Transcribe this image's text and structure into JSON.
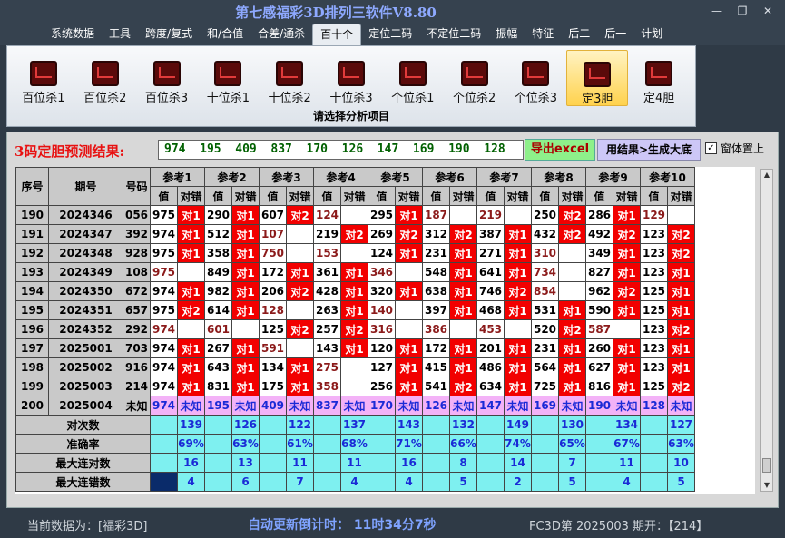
{
  "app": {
    "title": "第七感福彩3D排列三软件V8.80"
  },
  "window_controls": [
    "—",
    "❐",
    "✕"
  ],
  "menu": [
    "系统数据",
    "工具",
    "跨度/复式",
    "和/合值",
    "合差/通杀",
    "百十个",
    "定位二码",
    "不定位二码",
    "振幅",
    "特征",
    "后二",
    "后一",
    "计划"
  ],
  "menu_active": "百十个",
  "ribbon": {
    "items": [
      "百位杀1",
      "百位杀2",
      "百位杀3",
      "十位杀1",
      "十位杀2",
      "十位杀3",
      "个位杀1",
      "个位杀2",
      "个位杀3",
      "定3胆",
      "定4胆"
    ],
    "selected": "定3胆",
    "caption": "请选择分析项目"
  },
  "result": {
    "label": "3码定胆预测结果:",
    "value": "974  195  409  837  170  126  147  169  190  128",
    "export_button": "导出excel",
    "generate_button": "用结果>生成大底",
    "topmost_label": "窗体置上",
    "topmost_checked": true
  },
  "table": {
    "headers": {
      "seq": "序号",
      "period": "期号",
      "number": "号码",
      "value": "值",
      "result": "对错"
    },
    "ref_labels": [
      "参考1",
      "参考2",
      "参考3",
      "参考4",
      "参考5",
      "参考6",
      "参考7",
      "参考8",
      "参考9",
      "参考10"
    ],
    "rows": [
      {
        "seq": "190",
        "period": "2024346",
        "number": "056",
        "cells": [
          [
            "975",
            "对1"
          ],
          [
            "290",
            "对1"
          ],
          [
            "607",
            "对2"
          ],
          [
            "124",
            ""
          ],
          [
            "295",
            "对1"
          ],
          [
            "187",
            ""
          ],
          [
            "219",
            ""
          ],
          [
            "250",
            "对2"
          ],
          [
            "286",
            "对1"
          ],
          [
            "129",
            ""
          ]
        ]
      },
      {
        "seq": "191",
        "period": "2024347",
        "number": "392",
        "cells": [
          [
            "974",
            "对1"
          ],
          [
            "512",
            "对1"
          ],
          [
            "107",
            ""
          ],
          [
            "219",
            "对2"
          ],
          [
            "269",
            "对2"
          ],
          [
            "312",
            "对2"
          ],
          [
            "387",
            "对1"
          ],
          [
            "432",
            "对2"
          ],
          [
            "492",
            "对2"
          ],
          [
            "123",
            "对2"
          ]
        ]
      },
      {
        "seq": "192",
        "period": "2024348",
        "number": "928",
        "cells": [
          [
            "975",
            "对1"
          ],
          [
            "358",
            "对1"
          ],
          [
            "750",
            ""
          ],
          [
            "153",
            ""
          ],
          [
            "124",
            "对1"
          ],
          [
            "231",
            "对1"
          ],
          [
            "271",
            "对1"
          ],
          [
            "310",
            ""
          ],
          [
            "349",
            "对1"
          ],
          [
            "123",
            "对2"
          ]
        ]
      },
      {
        "seq": "193",
        "period": "2024349",
        "number": "108",
        "cells": [
          [
            "975",
            ""
          ],
          [
            "849",
            "对1"
          ],
          [
            "172",
            "对1"
          ],
          [
            "361",
            "对1"
          ],
          [
            "346",
            ""
          ],
          [
            "548",
            "对1"
          ],
          [
            "641",
            "对1"
          ],
          [
            "734",
            ""
          ],
          [
            "827",
            "对1"
          ],
          [
            "123",
            "对1"
          ]
        ]
      },
      {
        "seq": "194",
        "period": "2024350",
        "number": "672",
        "cells": [
          [
            "974",
            "对1"
          ],
          [
            "982",
            "对1"
          ],
          [
            "206",
            "对2"
          ],
          [
            "428",
            "对1"
          ],
          [
            "320",
            "对1"
          ],
          [
            "638",
            "对1"
          ],
          [
            "746",
            "对2"
          ],
          [
            "854",
            ""
          ],
          [
            "962",
            "对2"
          ],
          [
            "125",
            "对1"
          ]
        ]
      },
      {
        "seq": "195",
        "period": "2024351",
        "number": "657",
        "cells": [
          [
            "975",
            "对2"
          ],
          [
            "614",
            "对1"
          ],
          [
            "128",
            ""
          ],
          [
            "263",
            "对1"
          ],
          [
            "140",
            ""
          ],
          [
            "397",
            "对1"
          ],
          [
            "468",
            "对1"
          ],
          [
            "531",
            "对1"
          ],
          [
            "590",
            "对1"
          ],
          [
            "125",
            "对1"
          ]
        ]
      },
      {
        "seq": "196",
        "period": "2024352",
        "number": "292",
        "cells": [
          [
            "974",
            ""
          ],
          [
            "601",
            ""
          ],
          [
            "125",
            "对2"
          ],
          [
            "257",
            "对2"
          ],
          [
            "316",
            ""
          ],
          [
            "386",
            ""
          ],
          [
            "453",
            ""
          ],
          [
            "520",
            "对2"
          ],
          [
            "587",
            ""
          ],
          [
            "123",
            "对2"
          ]
        ]
      },
      {
        "seq": "197",
        "period": "2025001",
        "number": "703",
        "cells": [
          [
            "974",
            "对1"
          ],
          [
            "267",
            "对1"
          ],
          [
            "591",
            ""
          ],
          [
            "143",
            "对1"
          ],
          [
            "120",
            "对1"
          ],
          [
            "172",
            "对1"
          ],
          [
            "201",
            "对1"
          ],
          [
            "231",
            "对1"
          ],
          [
            "260",
            "对1"
          ],
          [
            "123",
            "对1"
          ]
        ]
      },
      {
        "seq": "198",
        "period": "2025002",
        "number": "916",
        "cells": [
          [
            "974",
            "对1"
          ],
          [
            "643",
            "对1"
          ],
          [
            "134",
            "对1"
          ],
          [
            "275",
            ""
          ],
          [
            "127",
            "对1"
          ],
          [
            "415",
            "对1"
          ],
          [
            "486",
            "对1"
          ],
          [
            "564",
            "对1"
          ],
          [
            "627",
            "对1"
          ],
          [
            "123",
            "对1"
          ]
        ]
      },
      {
        "seq": "199",
        "period": "2025003",
        "number": "214",
        "cells": [
          [
            "974",
            "对1"
          ],
          [
            "831",
            "对1"
          ],
          [
            "175",
            "对1"
          ],
          [
            "358",
            ""
          ],
          [
            "256",
            "对1"
          ],
          [
            "541",
            "对2"
          ],
          [
            "634",
            "对1"
          ],
          [
            "725",
            "对1"
          ],
          [
            "816",
            "对1"
          ],
          [
            "125",
            "对2"
          ]
        ]
      }
    ],
    "future": {
      "seq": "200",
      "period": "2025004",
      "number": "未知",
      "values": [
        "974",
        "195",
        "409",
        "837",
        "170",
        "126",
        "147",
        "169",
        "190",
        "128"
      ],
      "status": "未知"
    },
    "stats": [
      {
        "label": "对次数",
        "values": [
          "139",
          "126",
          "122",
          "137",
          "143",
          "132",
          "149",
          "130",
          "134",
          "127"
        ]
      },
      {
        "label": "准确率",
        "values": [
          "69%",
          "63%",
          "61%",
          "68%",
          "71%",
          "66%",
          "74%",
          "65%",
          "67%",
          "63%"
        ]
      },
      {
        "label": "最大连对数",
        "values": [
          "16",
          "13",
          "11",
          "11",
          "16",
          "8",
          "14",
          "7",
          "11",
          "10"
        ]
      },
      {
        "label": "最大连错数",
        "values": [
          "4",
          "6",
          "7",
          "4",
          "4",
          "5",
          "2",
          "5",
          "4",
          "5"
        ]
      }
    ]
  },
  "status": {
    "source": "当前数据为：[福彩3D]",
    "countdown": "自动更新倒计时：  11时34分7秒",
    "draw": "FC3D第 2025003 期开：【214】"
  }
}
